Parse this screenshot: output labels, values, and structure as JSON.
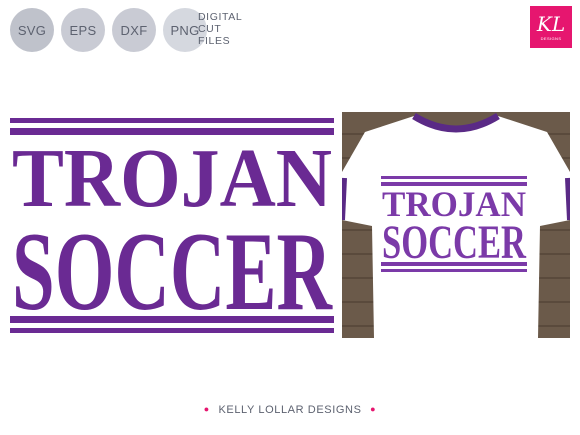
{
  "badges": [
    "SVG",
    "EPS",
    "DXF",
    "PNG"
  ],
  "cut_label": [
    "DIGITAL",
    "CUT",
    "FILES"
  ],
  "logo": {
    "text": "KL",
    "sub": "DESIGNS"
  },
  "design": {
    "line1": "TROJAN",
    "line2": "SOCCER"
  },
  "shirt": {
    "line1": "TROJAN",
    "line2": "SOCCER"
  },
  "footer": {
    "text": "KELLY LOLLAR DESIGNS",
    "dot": "●"
  },
  "colors": {
    "purple": "#6a2a93",
    "pink": "#e6166f",
    "badge": "#c9cbd4",
    "wood": "#6b5a4a"
  }
}
